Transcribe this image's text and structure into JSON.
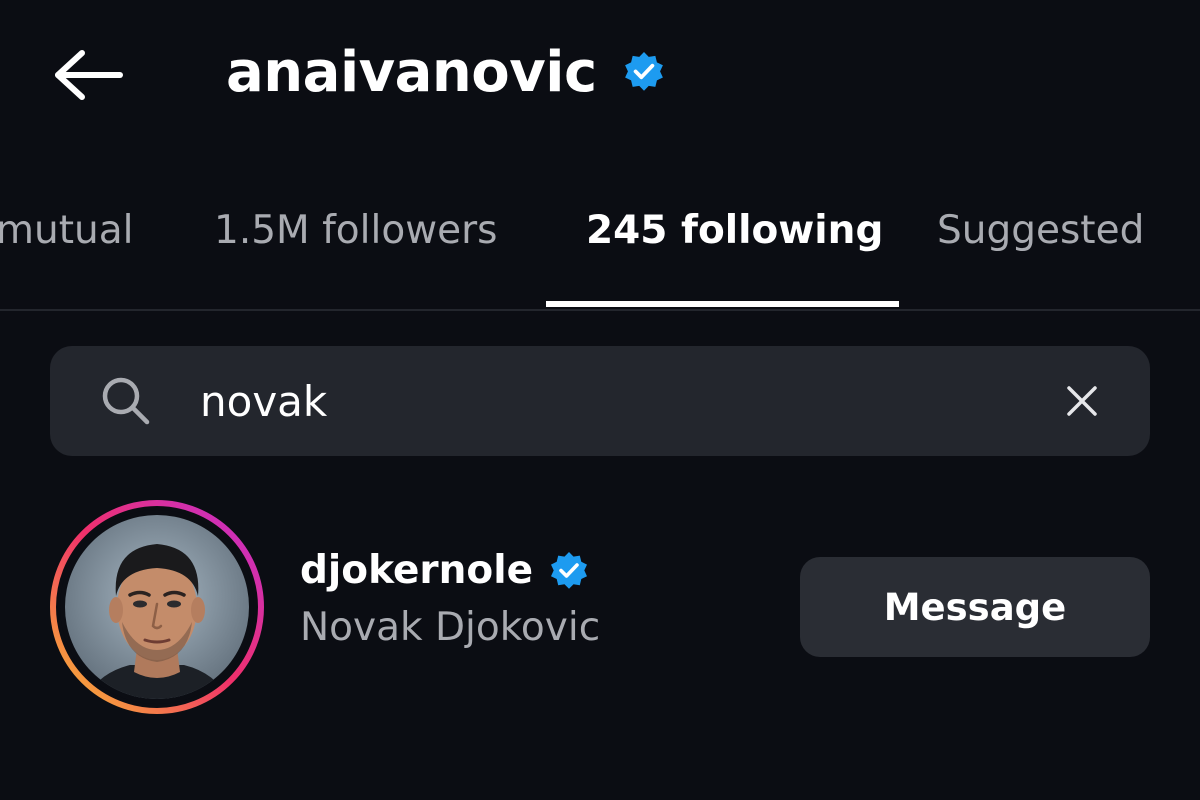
{
  "header": {
    "back_icon": "arrow-left-icon",
    "title": "anaivanovic",
    "verified_icon": "verified-badge-icon"
  },
  "tabs": [
    {
      "label": "mutual",
      "active": false
    },
    {
      "label": "1.5M followers",
      "active": false
    },
    {
      "label": "245 following",
      "active": true
    },
    {
      "label": "Suggested",
      "active": false
    }
  ],
  "search": {
    "icon": "search-icon",
    "value": "novak",
    "clear_icon": "close-icon"
  },
  "results": [
    {
      "username": "djokernole",
      "verified": true,
      "full_name": "Novak Djokovic",
      "action_label": "Message"
    }
  ],
  "colors": {
    "background": "#0b0d13",
    "surface": "#23262d",
    "button": "#2a2d34",
    "text_primary": "#ffffff",
    "text_secondary": "#a9abb1",
    "verified_blue": "#1d9bf0",
    "story_ring_start": "#f9c22e",
    "story_ring_mid": "#f0306a",
    "story_ring_end": "#c22fd3"
  }
}
